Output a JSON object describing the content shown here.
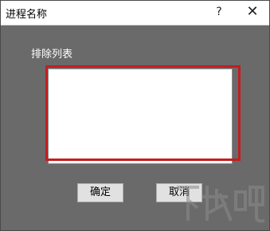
{
  "window": {
    "title": "进程名称",
    "help_glyph": "?",
    "close_glyph": "✕"
  },
  "list": {
    "label": "排除列表",
    "items": []
  },
  "buttons": {
    "ok_label": "确定",
    "cancel_label": "取消"
  },
  "watermark": {
    "text": "下载吧"
  },
  "colors": {
    "background": "#6a6a6a",
    "highlight": "#c41d20",
    "list_bg": "#ffffff"
  }
}
